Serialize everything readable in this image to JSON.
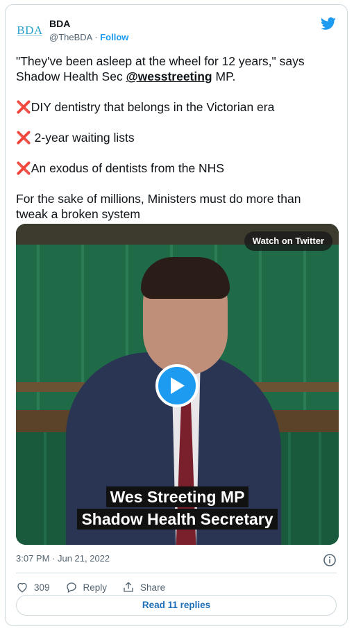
{
  "account": {
    "logo_text": "BDA",
    "display_name": "BDA",
    "handle": "@TheBDA",
    "separator": "·",
    "follow_label": "Follow"
  },
  "tweet": {
    "line1_prefix": "\"They've been asleep at the wheel for 12 years,\" says Shadow Health Sec ",
    "mention": "@wesstreeting",
    "line1_suffix": " MP.",
    "bullet1_mark": "❌",
    "bullet1": "DIY dentistry that belongs in the Victorian era",
    "bullet2_mark": "❌",
    "bullet2": " 2-year waiting lists",
    "bullet3_mark": "❌",
    "bullet3": "An exodus of dentists from the NHS",
    "closing": "For the sake of millions, Ministers must do more than tweak a broken system"
  },
  "media": {
    "watch_label": "Watch on Twitter",
    "caption_line1": "Wes Streeting MP",
    "caption_line2": "Shadow Health Secretary"
  },
  "meta": {
    "timestamp": "3:07 PM · Jun 21, 2022"
  },
  "actions": {
    "like_count": "309",
    "reply_label": "Reply",
    "share_label": "Share",
    "read_replies_label": "Read 11 replies"
  },
  "colors": {
    "accent": "#1d9bf0",
    "mention": "#0f1419",
    "xmark": "#e0323c"
  }
}
